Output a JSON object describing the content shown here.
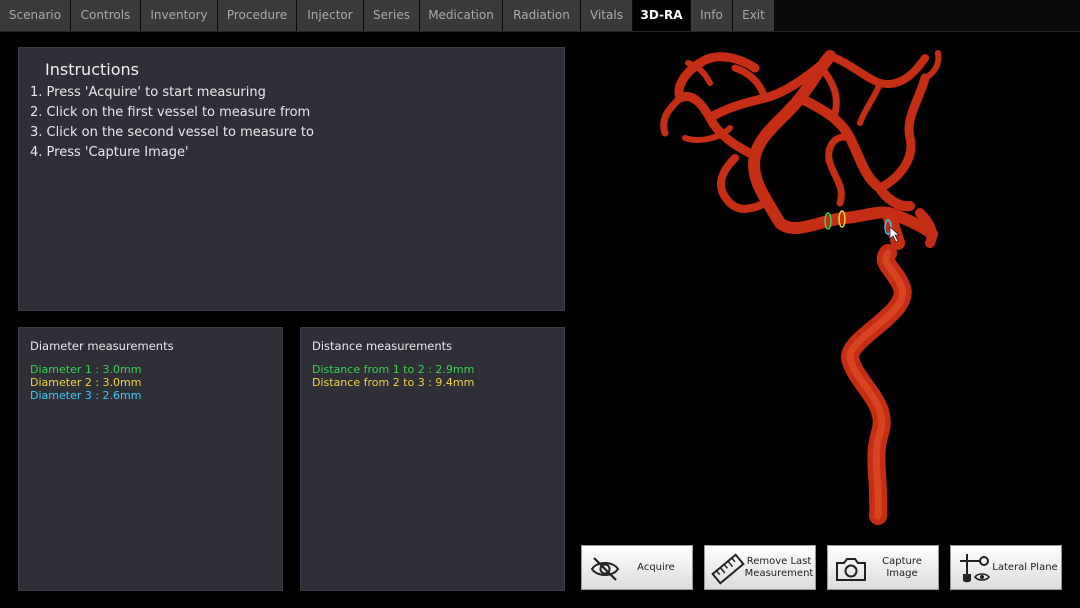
{
  "tabs": [
    "Scenario",
    "Controls",
    "Inventory",
    "Procedure",
    "Injector",
    "Series",
    "Medication",
    "Radiation",
    "Vitals",
    "3D-RA",
    "Info",
    "Exit"
  ],
  "active_tab": "3D-RA",
  "instructions": {
    "title": "Instructions",
    "steps": [
      "1. Press 'Acquire' to start measuring",
      "2. Click on the first vessel to measure from",
      "3. Click on the second vessel to measure to",
      "4. Press 'Capture Image'"
    ]
  },
  "diameter": {
    "title": "Diameter measurements",
    "items": [
      {
        "text": "Diameter 1 : 3.0mm",
        "color": "#33d64a"
      },
      {
        "text": "Diameter 2 : 3.0mm",
        "color": "#f2d23a"
      },
      {
        "text": "Diameter 3 : 2.6mm",
        "color": "#3ec9ee"
      }
    ]
  },
  "distance": {
    "title": "Distance measurements",
    "items": [
      {
        "text": "Distance from 1 to 2 : 2.9mm",
        "color": "#33d64a"
      },
      {
        "text": "Distance from 2 to 3 : 9.4mm",
        "color": "#f2d23a"
      }
    ]
  },
  "buttons": {
    "acquire": "Acquire",
    "remove_last": "Remove Last\nMeasurement",
    "capture": "Capture\nImage",
    "lateral": "Lateral Plane"
  },
  "icons": {
    "acquire": "eye-slash-icon",
    "remove_last": "ruler-icon",
    "capture": "camera-icon",
    "lateral": "lateral-plane-icon"
  },
  "colors": {
    "vessel": "#d8341a",
    "panel": "#2f2f38",
    "active_tab": "#000000"
  }
}
